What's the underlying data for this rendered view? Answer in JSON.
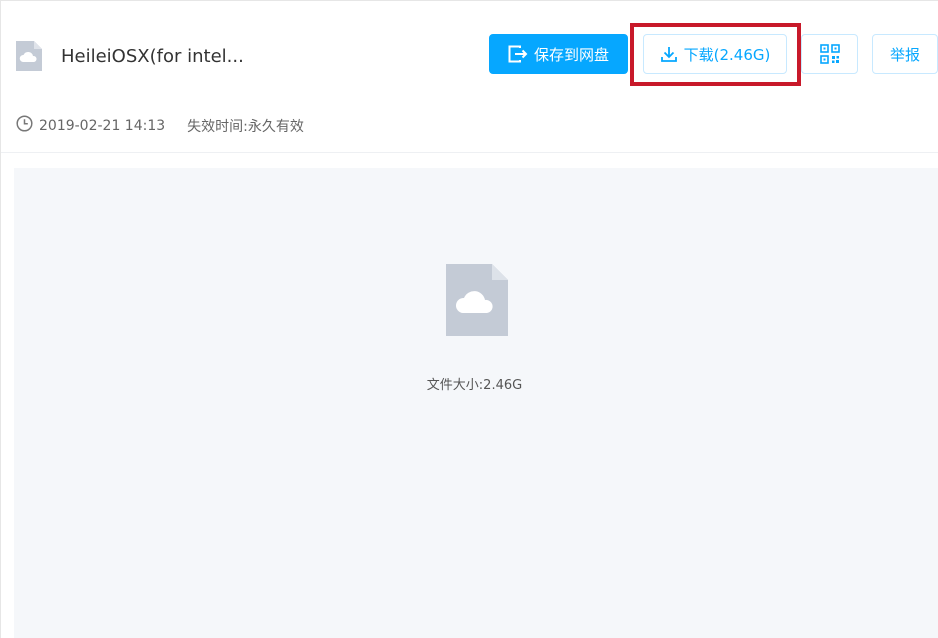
{
  "file": {
    "title": "HeileiOSX(for intel...",
    "date": "2019-02-21 14:13",
    "expire_label": "失效时间:",
    "expire_value": "永久有效"
  },
  "toolbar": {
    "save_label": "保存到网盘",
    "download_label": "下载(2.46G)",
    "report_label": "举报"
  },
  "preview": {
    "size_text": "文件大小:2.46G"
  },
  "colors": {
    "primary": "#06a7ff",
    "highlight": "#c8192a",
    "preview_bg": "#f5f7fa",
    "file_icon": "#c4cbd6"
  },
  "icons": {
    "file": "cloud-file-icon",
    "save": "save-export-icon",
    "download": "download-icon",
    "qr": "qr-code-icon",
    "clock": "clock-icon"
  }
}
